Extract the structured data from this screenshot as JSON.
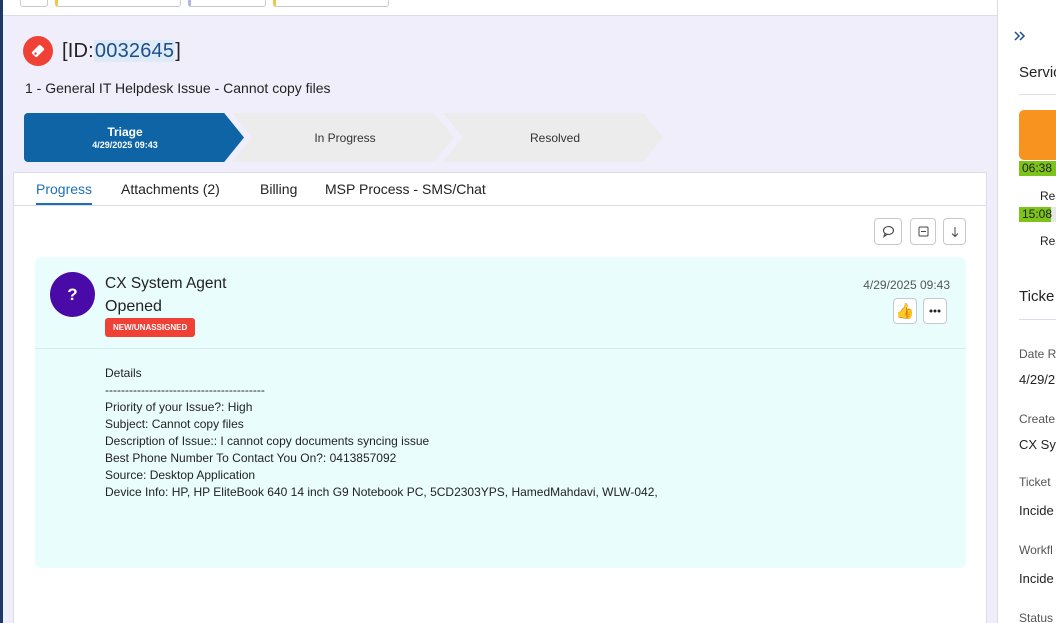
{
  "ticket": {
    "id_prefix": "[ID:",
    "id_number": "0032645",
    "id_suffix": "]",
    "subtitle": "1 - General IT Helpdesk Issue - Cannot copy files"
  },
  "stepper": [
    {
      "label": "Triage",
      "date": "4/29/2025 09:43",
      "active": true
    },
    {
      "label": "In Progress"
    },
    {
      "label": "Resolved"
    }
  ],
  "tabs": [
    {
      "label": "Progress",
      "active": true
    },
    {
      "label": "Attachments (2)"
    },
    {
      "label": "Billing"
    },
    {
      "label": "MSP Process - SMS/Chat"
    }
  ],
  "toolbar_icons": [
    "comment-icon",
    "collapse-all-icon",
    "sort-down-icon"
  ],
  "entry": {
    "avatar_text": "?",
    "agent": "CX System Agent",
    "status": "Opened",
    "badge": "NEW/UNASSIGNED",
    "date": "4/29/2025 09:43",
    "details": "Details\n----------------------------------------\nPriority of your Issue?: High\nSubject: Cannot copy files\nDescription of Issue:: I cannot copy documents syncing issue\nBest Phone Number To Contact You On?: 0413857092\nSource: Desktop Application\nDevice Info: HP, HP EliteBook 640 14 inch G9 Notebook PC, 5CD2303YPS, HamedMahdavi, WLW-042,"
  },
  "right_panel": {
    "service_heading": "Servic",
    "timer1": "06:38",
    "timer1_label": "Res",
    "timer2": "15:08",
    "timer2_label": "Res",
    "ticket_heading": "Ticke",
    "fields": [
      {
        "label": "Date R",
        "value": "4/29/2"
      },
      {
        "label": "Create",
        "value": "CX Sys"
      },
      {
        "label": "Ticket",
        "value": "Incide"
      },
      {
        "label": "Workfl",
        "value": "Incide"
      },
      {
        "label": "Status",
        "value": ""
      }
    ]
  },
  "colors": {
    "accent": "#0f64a6",
    "badge_red": "#ef4136",
    "avatar_purple": "#4a0aa8",
    "entry_bg": "#eafdfd",
    "timer_green": "#7dc31a",
    "sla_orange": "#f7931e"
  }
}
